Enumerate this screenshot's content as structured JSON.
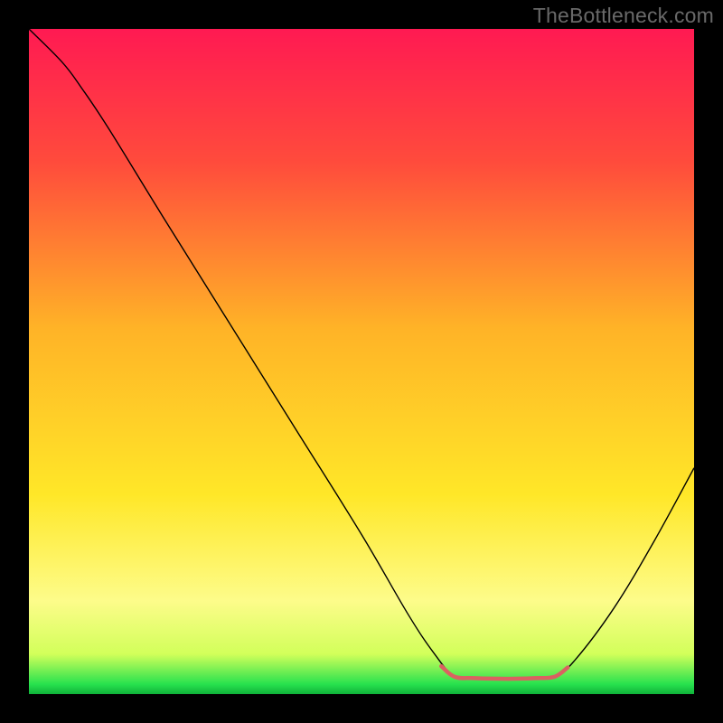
{
  "watermark": "TheBottleneck.com",
  "chart_data": {
    "type": "line",
    "title": "",
    "xlabel": "",
    "ylabel": "",
    "xlim": [
      0,
      100
    ],
    "ylim": [
      0,
      100
    ],
    "background_gradient": {
      "stops": [
        {
          "offset": 0.0,
          "color": "#ff1a52"
        },
        {
          "offset": 0.2,
          "color": "#ff4b3c"
        },
        {
          "offset": 0.45,
          "color": "#ffb327"
        },
        {
          "offset": 0.7,
          "color": "#ffe728"
        },
        {
          "offset": 0.86,
          "color": "#fdfc8a"
        },
        {
          "offset": 0.94,
          "color": "#d2ff5a"
        },
        {
          "offset": 0.985,
          "color": "#28e24e"
        },
        {
          "offset": 1.0,
          "color": "#0fb33a"
        }
      ]
    },
    "series": [
      {
        "name": "curve",
        "color": "#000000",
        "width": 1.4,
        "points": [
          {
            "x": 0,
            "y": 100
          },
          {
            "x": 5,
            "y": 95
          },
          {
            "x": 8,
            "y": 91
          },
          {
            "x": 12,
            "y": 85
          },
          {
            "x": 20,
            "y": 72
          },
          {
            "x": 30,
            "y": 56
          },
          {
            "x": 40,
            "y": 40
          },
          {
            "x": 50,
            "y": 24
          },
          {
            "x": 57,
            "y": 12
          },
          {
            "x": 61,
            "y": 6
          },
          {
            "x": 64,
            "y": 2.6
          },
          {
            "x": 67,
            "y": 2.4
          },
          {
            "x": 72,
            "y": 2.3
          },
          {
            "x": 76,
            "y": 2.4
          },
          {
            "x": 79,
            "y": 2.6
          },
          {
            "x": 82,
            "y": 5
          },
          {
            "x": 88,
            "y": 13
          },
          {
            "x": 94,
            "y": 23
          },
          {
            "x": 100,
            "y": 34
          }
        ]
      },
      {
        "name": "highlight",
        "color": "#da6161",
        "width": 4.5,
        "points": [
          {
            "x": 62,
            "y": 4.2
          },
          {
            "x": 64,
            "y": 2.6
          },
          {
            "x": 67,
            "y": 2.4
          },
          {
            "x": 72,
            "y": 2.3
          },
          {
            "x": 76,
            "y": 2.4
          },
          {
            "x": 79,
            "y": 2.6
          },
          {
            "x": 81,
            "y": 4.0
          }
        ]
      }
    ]
  }
}
